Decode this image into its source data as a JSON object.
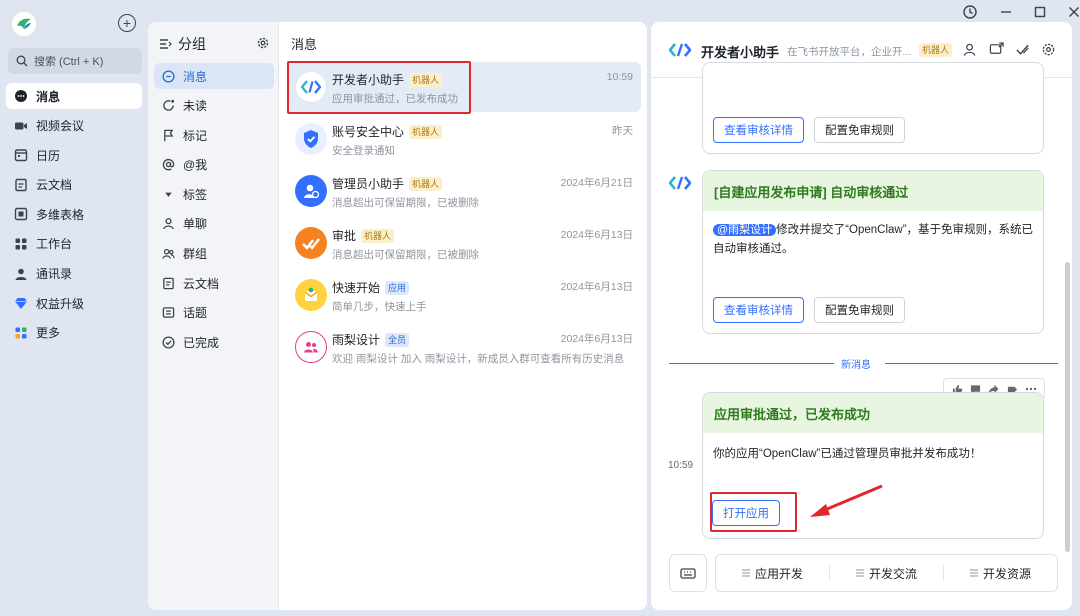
{
  "window": {
    "controls": [
      "history-icon",
      "minimize-icon",
      "maximize-icon",
      "close-icon"
    ]
  },
  "nav": {
    "search_placeholder": "搜索 (Ctrl + K)",
    "items": [
      {
        "label": "消息",
        "icon": "chat-bubble-icon",
        "active": true
      },
      {
        "label": "视频会议",
        "icon": "video-icon"
      },
      {
        "label": "日历",
        "icon": "calendar-icon"
      },
      {
        "label": "云文档",
        "icon": "document-icon"
      },
      {
        "label": "多维表格",
        "icon": "table-icon"
      },
      {
        "label": "工作台",
        "icon": "grid-icon"
      },
      {
        "label": "通讯录",
        "icon": "contacts-icon"
      },
      {
        "label": "权益升级",
        "icon": "diamond-icon"
      },
      {
        "label": "更多",
        "icon": "more-apps-icon"
      }
    ]
  },
  "groups": {
    "title": "分组",
    "items": [
      {
        "label": "消息",
        "active": true
      },
      {
        "label": "未读"
      },
      {
        "label": "标记"
      },
      {
        "label": "@我"
      },
      {
        "label": "标签"
      },
      {
        "label": "单聊"
      },
      {
        "label": "群组"
      },
      {
        "label": "云文档"
      },
      {
        "label": "话题"
      },
      {
        "label": "已完成"
      }
    ]
  },
  "message_list": {
    "title": "消息",
    "conversations": [
      {
        "name": "开发者小助手",
        "tag": "机器人",
        "tag_type": "bot",
        "preview": "应用审批通过，已发布成功",
        "time": "10:59",
        "active": true
      },
      {
        "name": "账号安全中心",
        "tag": "机器人",
        "tag_type": "bot",
        "preview": "安全登录通知",
        "time": "昨天"
      },
      {
        "name": "管理员小助手",
        "tag": "机器人",
        "tag_type": "bot",
        "preview": "消息超出可保留期限，已被删除",
        "time": "2024年6月21日"
      },
      {
        "name": "审批",
        "tag": "机器人",
        "tag_type": "bot",
        "preview": "消息超出可保留期限，已被删除",
        "time": "2024年6月13日"
      },
      {
        "name": "快速开始",
        "tag": "应用",
        "tag_type": "app",
        "preview": "简单几步，快速上手",
        "time": "2024年6月13日"
      },
      {
        "name": "雨梨设计",
        "tag": "全员",
        "tag_type": "member",
        "preview": "欢迎 雨梨设计 加入 雨梨设计，新成员入群可查看所有历史消息",
        "time": "2024年6月13日"
      }
    ]
  },
  "chat": {
    "title": "开发者小助手",
    "description": "在飞书开放平台，企业开...",
    "tag": "机器人",
    "card1": {
      "btn_details": "查看审核详情",
      "btn_rules": "配置免审规则"
    },
    "card2": {
      "title": "[自建应用发布申请] 自动审核通过",
      "mention": "@雨梨设计",
      "body": "修改并提交了“OpenClaw”，基于免审规则，系统已自动审核通过。",
      "btn_details": "查看审核详情",
      "btn_rules": "配置免审规则"
    },
    "new_messages_divider": "新消息",
    "card3": {
      "time": "10:59",
      "title": "应用审批通过，已发布成功",
      "body": "你的应用“OpenClaw”已通过管理员审批并发布成功！",
      "btn_open": "打开应用"
    },
    "composer": {
      "items": [
        "应用开发",
        "开发交流",
        "开发资源"
      ]
    }
  }
}
